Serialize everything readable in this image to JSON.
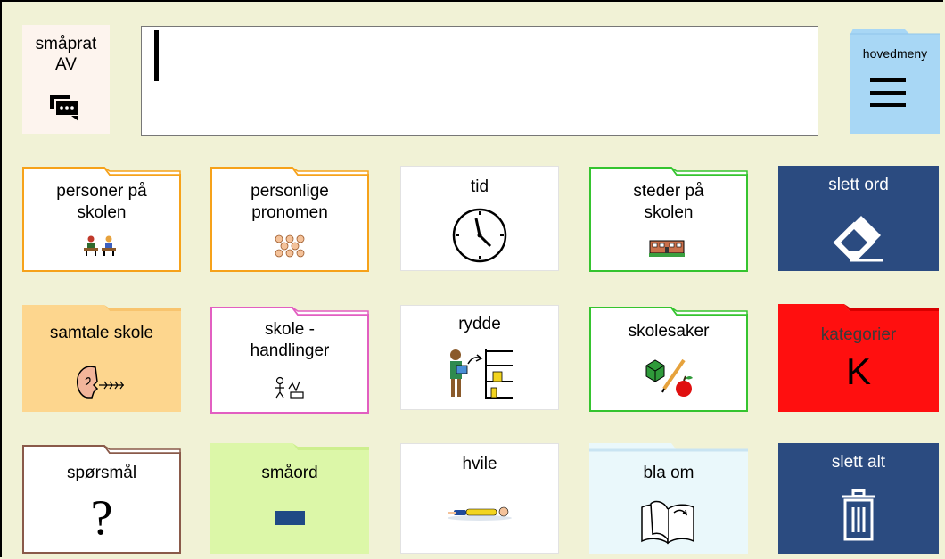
{
  "talk_toggle": {
    "line1": "småprat",
    "line2": "AV",
    "icon": "chat-bubbles-icon"
  },
  "message_bar": {
    "value": ""
  },
  "main_menu": {
    "label": "hovedmeny",
    "icon": "hamburger-menu-icon"
  },
  "grid": [
    {
      "label1": "personer på",
      "label2": "skolen",
      "icon": "school-people-icon"
    },
    {
      "label1": "personlige",
      "label2": "pronomen",
      "icon": "faces-group-icon"
    },
    {
      "label1": "tid",
      "label2": "",
      "icon": "clock-icon"
    },
    {
      "label1": "steder på",
      "label2": "skolen",
      "icon": "school-building-icon"
    },
    {
      "label1": "slett ord",
      "label2": "",
      "icon": "eraser-icon"
    },
    {
      "label1": "samtale skole",
      "label2": "",
      "icon": "speaking-head-icon"
    },
    {
      "label1": "skole -",
      "label2": "handlinger",
      "icon": "school-actions-icon"
    },
    {
      "label1": "rydde",
      "label2": "",
      "icon": "tidy-shelf-icon"
    },
    {
      "label1": "skolesaker",
      "label2": "",
      "icon": "school-supplies-icon"
    },
    {
      "label1": "kategorier",
      "label2": "",
      "glyph": "K"
    },
    {
      "label1": "spørsmål",
      "label2": "",
      "glyph": "?"
    },
    {
      "label1": "småord",
      "label2": "",
      "icon": "blue-bar-icon"
    },
    {
      "label1": "hvile",
      "label2": "",
      "icon": "resting-person-icon"
    },
    {
      "label1": "bla om",
      "label2": "",
      "icon": "page-turn-book-icon"
    },
    {
      "label1": "slett alt",
      "label2": "",
      "icon": "trash-icon"
    }
  ],
  "colors": {
    "background": "#f1f2d6",
    "orange_folder": "#f6a21a",
    "pink_folder": "#e25fc1",
    "green_folder": "#35c42f",
    "brown_folder": "#8a5a4a",
    "navy_button": "#2b4b80",
    "red_button": "#ff0f0f",
    "peach_folder": "#fdd68e",
    "lime_folder": "#dcf7a8",
    "light_blue_folder": "#eaf8fb",
    "menu_blue": "#a8d7f5"
  }
}
